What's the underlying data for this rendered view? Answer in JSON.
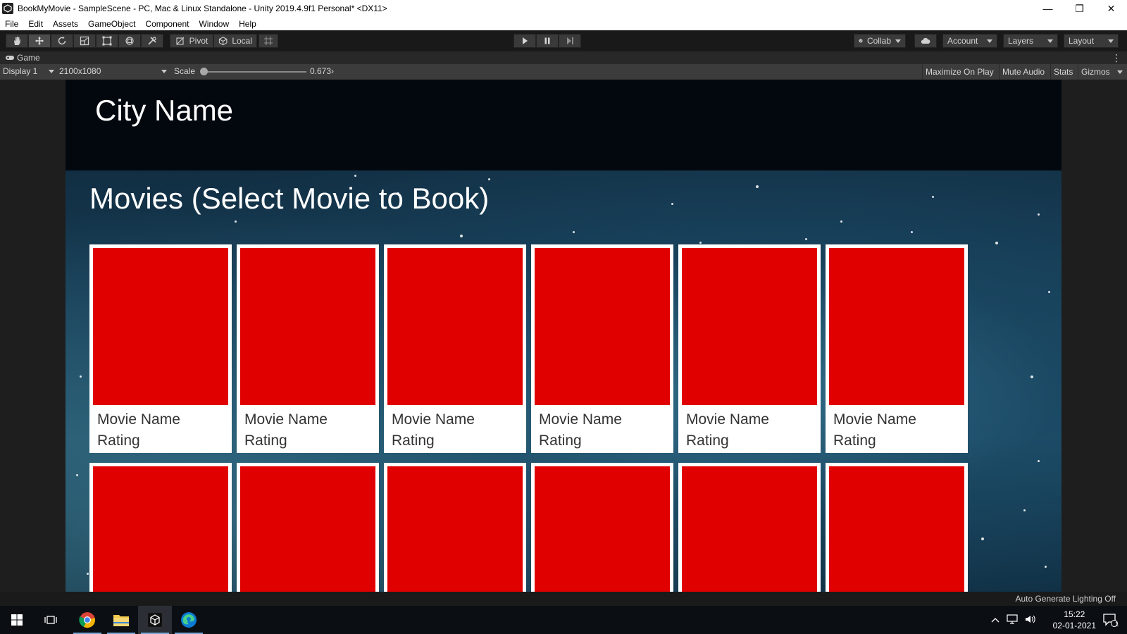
{
  "window": {
    "title": "BookMyMovie - SampleScene - PC, Mac & Linux Standalone - Unity 2019.4.9f1 Personal* <DX11>",
    "minimize": "—",
    "restore": "❐",
    "close": "✕"
  },
  "menu": [
    "File",
    "Edit",
    "Assets",
    "GameObject",
    "Component",
    "Window",
    "Help"
  ],
  "toolbar": {
    "pivot_label": "Pivot",
    "local_label": "Local",
    "collab_label": "Collab",
    "account_label": "Account",
    "layers_label": "Layers",
    "layout_label": "Layout"
  },
  "game_view": {
    "tab_label": "Game",
    "display_label": "Display 1",
    "resolution_label": "2100x1080",
    "scale_label": "Scale",
    "scale_value": "0.673",
    "scale_value_suffix": "›",
    "options": [
      "Maximize On Play",
      "Mute Audio",
      "Stats",
      "Gizmos"
    ]
  },
  "scene": {
    "city_name": "City Name",
    "section_title": "Movies (Select Movie to Book)",
    "movies": [
      {
        "name": "Movie Name",
        "rating": "Rating"
      },
      {
        "name": "Movie Name",
        "rating": "Rating"
      },
      {
        "name": "Movie Name",
        "rating": "Rating"
      },
      {
        "name": "Movie Name",
        "rating": "Rating"
      },
      {
        "name": "Movie Name",
        "rating": "Rating"
      },
      {
        "name": "Movie Name",
        "rating": "Rating"
      }
    ],
    "poster_color": "#e00000"
  },
  "status": {
    "lighting": "Auto Generate Lighting Off"
  },
  "taskbar": {
    "time": "15:22",
    "date": "02-01-2021",
    "notification_count": "1"
  }
}
